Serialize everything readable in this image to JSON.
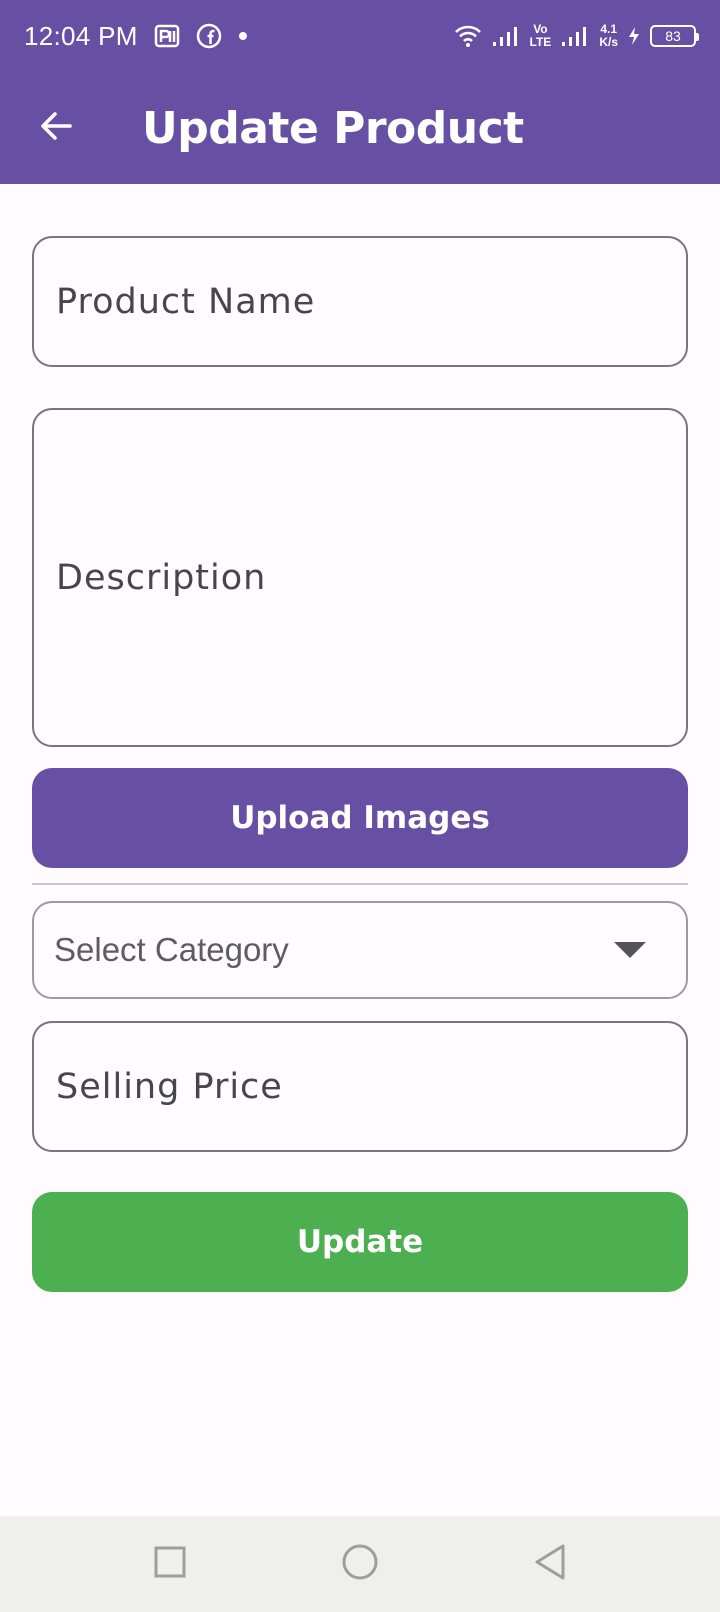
{
  "status_bar": {
    "time": "12:04 PM",
    "network_top": "Vo",
    "network_bottom": "LTE",
    "speed_value": "4.1",
    "speed_unit": "K/s",
    "battery": "83"
  },
  "app_bar": {
    "title": "Update Product",
    "back_icon": "arrow-left-icon"
  },
  "form": {
    "product_name_placeholder": "Product Name",
    "description_placeholder": "Description",
    "upload_images_label": "Upload Images",
    "category_placeholder": "Select Category",
    "selling_price_placeholder": "Selling Price",
    "update_label": "Update"
  },
  "colors": {
    "primary": "#6750a4",
    "update_button": "#4caf50",
    "field_border": "#79747e"
  },
  "nav_bar": {
    "recents_icon": "square-icon",
    "home_icon": "circle-icon",
    "back_icon": "triangle-back-icon"
  }
}
